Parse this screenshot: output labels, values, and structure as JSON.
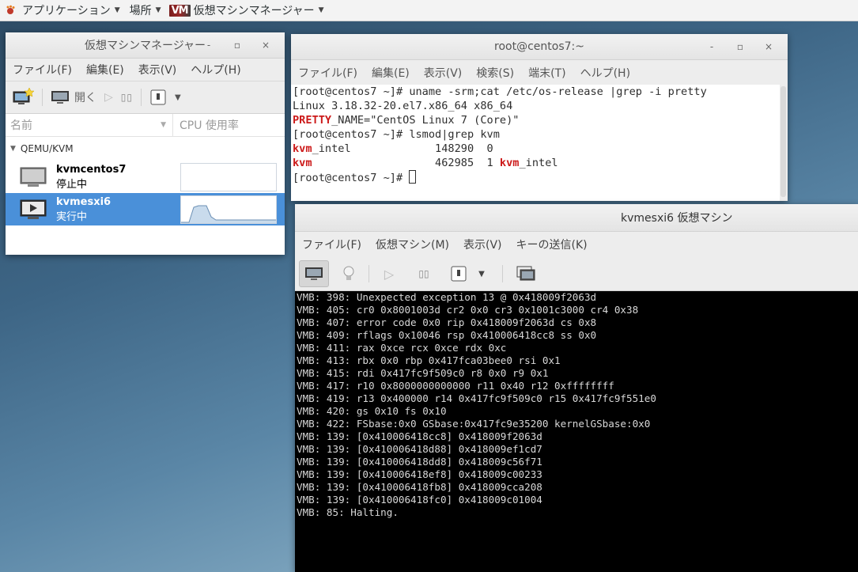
{
  "topbar": {
    "apps_label": "アプリケーション",
    "places_label": "場所",
    "active_app_label": "仮想マシンマネージャー"
  },
  "vmm": {
    "title": "仮想マシンマネージャー",
    "menu": [
      "ファイル(F)",
      "編集(E)",
      "表示(V)",
      "ヘルプ(H)"
    ],
    "toolbar": {
      "open_label": "開く"
    },
    "columns": {
      "name": "名前",
      "cpu": "CPU 使用率"
    },
    "group": "QEMU/KVM",
    "vms": [
      {
        "name": "kvmcentos7",
        "status": "停止中",
        "selected": false
      },
      {
        "name": "kvmesxi6",
        "status": "実行中",
        "selected": true
      }
    ]
  },
  "terminal": {
    "title": "root@centos7:~",
    "menu": [
      "ファイル(F)",
      "編集(E)",
      "表示(V)",
      "検索(S)",
      "端末(T)",
      "ヘルプ(H)"
    ],
    "lines": [
      [
        {
          "t": "[root@centos7 ~]# uname -srm;cat /etc/os-release |grep -i pretty"
        }
      ],
      [
        {
          "t": "Linux 3.18.32-20.el7.x86_64 x86_64"
        }
      ],
      [
        {
          "t": "PRETTY",
          "red": true
        },
        {
          "t": "_NAME=\"CentOS Linux 7 (Core)\""
        }
      ],
      [
        {
          "t": "[root@centos7 ~]# lsmod|grep kvm"
        }
      ],
      [
        {
          "t": "kvm",
          "red": true
        },
        {
          "t": "_intel             148290  0"
        }
      ],
      [
        {
          "t": "kvm",
          "red": true
        },
        {
          "t": "                   462985  1 "
        },
        {
          "t": "kvm",
          "red": true
        },
        {
          "t": "_intel"
        }
      ],
      [
        {
          "t": "[root@centos7 ~]# "
        },
        {
          "cursor": true
        }
      ]
    ]
  },
  "vmconsole": {
    "title": "kvmesxi6 仮想マシン",
    "menu": [
      "ファイル(F)",
      "仮想マシン(M)",
      "表示(V)",
      "キーの送信(K)"
    ],
    "lines": [
      "VMB: 398: Unexpected exception 13 @ 0x418009f2063d",
      "VMB: 405: cr0 0x8001003d cr2 0x0 cr3 0x1001c3000 cr4 0x38",
      "VMB: 407: error code 0x0 rip 0x418009f2063d cs 0x8",
      "VMB: 409: rflags 0x10046 rsp 0x410006418cc8 ss 0x0",
      "VMB: 411: rax 0xce rcx 0xce rdx 0xc",
      "VMB: 413: rbx 0x0 rbp 0x417fca03bee0 rsi 0x1",
      "VMB: 415: rdi 0x417fc9f509c0 r8 0x0 r9 0x1",
      "VMB: 417: r10 0x8000000000000 r11 0x40 r12 0xffffffff",
      "VMB: 419: r13 0x400000 r14 0x417fc9f509c0 r15 0x417fc9f551e0",
      "VMB: 420: gs 0x10 fs 0x10",
      "VMB: 422: FSbase:0x0 GSbase:0x417fc9e35200 kernelGSbase:0x0",
      "VMB: 139: [0x410006418cc8] 0x418009f2063d",
      "VMB: 139: [0x410006418d88] 0x418009ef1cd7",
      "VMB: 139: [0x410006418dd8] 0x418009c56f71",
      "VMB: 139: [0x410006418ef8] 0x418009c00233",
      "VMB: 139: [0x410006418fb8] 0x418009cca208",
      "VMB: 139: [0x410006418fc0] 0x418009c01004",
      "VMB: 85: Halting."
    ]
  }
}
